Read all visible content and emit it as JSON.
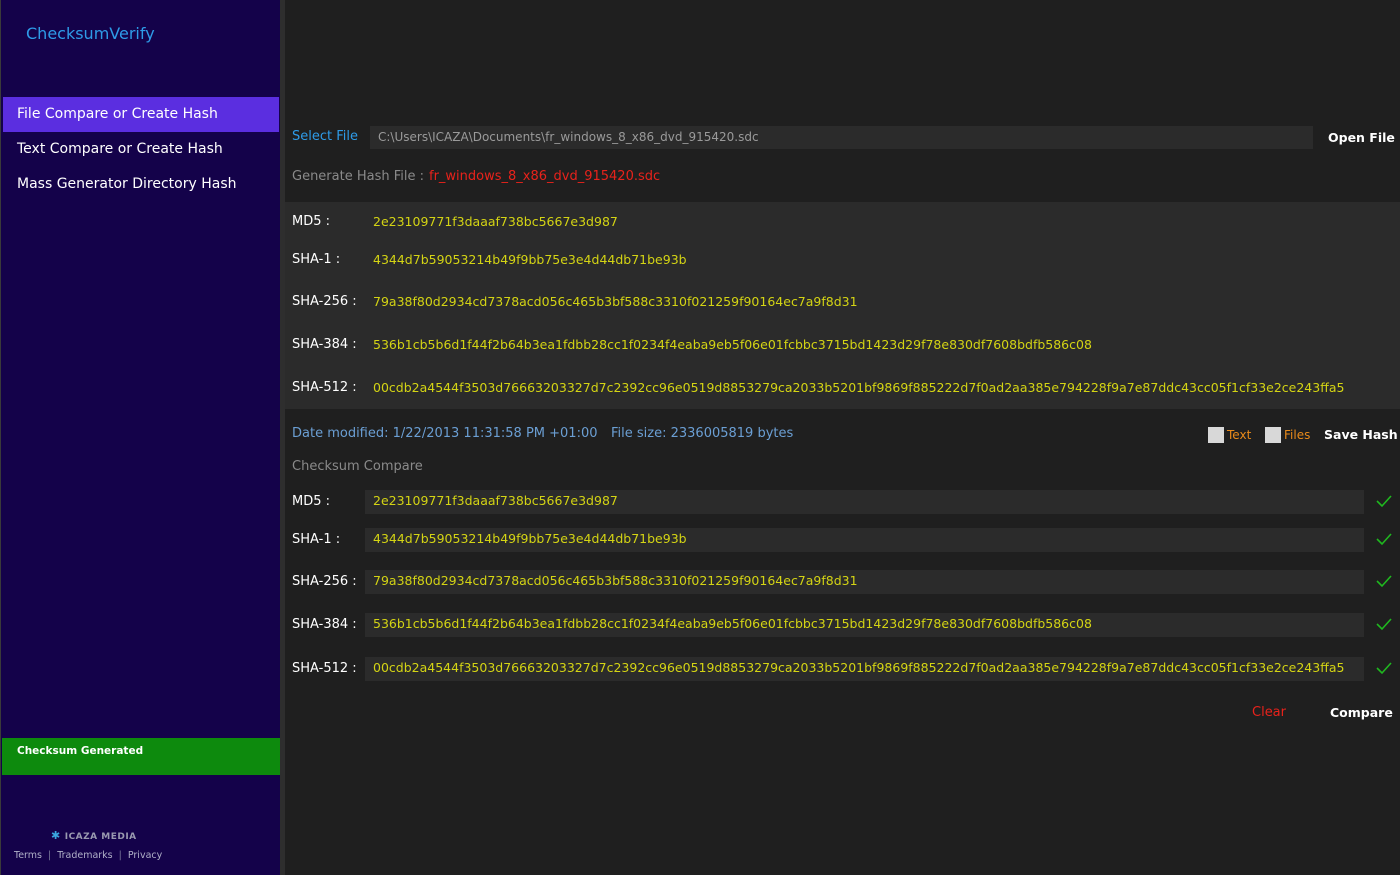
{
  "sidebar": {
    "app_title": "ChecksumVerify",
    "items": [
      {
        "label": "File Compare or Create Hash",
        "active": true
      },
      {
        "label": "Text Compare or Create Hash",
        "active": false
      },
      {
        "label": "Mass Generator Directory Hash",
        "active": false
      }
    ],
    "status": "Checksum Generated",
    "brand": "ICAZA MEDIA",
    "brand_icon": "puzzle-icon",
    "links": [
      "Terms",
      "Trademarks",
      "Privacy"
    ]
  },
  "file": {
    "select_label": "Select File",
    "path": "C:\\Users\\ICAZA\\Documents\\fr_windows_8_x86_dvd_915420.sdc",
    "open_label": "Open File",
    "generate_label": "Generate Hash File :",
    "generate_value": "fr_windows_8_x86_dvd_915420.sdc"
  },
  "hashes": [
    {
      "label": "MD5 :",
      "value": "2e23109771f3daaaf738bc5667e3d987"
    },
    {
      "label": "SHA-1 :",
      "value": "4344d7b59053214b49f9bb75e3e4d44db71be93b"
    },
    {
      "label": "SHA-256 :",
      "value": "79a38f80d2934cd7378acd056c465b3bf588c3310f021259f90164ec7a9f8d31"
    },
    {
      "label": "SHA-384 :",
      "value": "536b1cb5b6d1f44f2b64b3ea1fdbb28cc1f0234f4eaba9eb5f06e01fcbbc3715bd1423d29f78e830df7608bdfb586c08"
    },
    {
      "label": "SHA-512 :",
      "value": "00cdb2a4544f3503d76663203327d7c2392cc96e0519d8853279ca2033b5201bf9869f885222d7f0ad2aa385e794228f9a7e87ddc43cc05f1cf33e2ce243ffa5"
    }
  ],
  "info": {
    "date_modified": "Date modified: 1/22/2013 11:31:58 PM +01:00",
    "file_size": "File size: 2336005819 bytes",
    "text_checkbox": "Text",
    "files_checkbox": "Files",
    "save_hash": "Save Hash"
  },
  "compare": {
    "title": "Checksum Compare",
    "rows": [
      {
        "label": "MD5 :",
        "value": "2e23109771f3daaaf738bc5667e3d987",
        "match": true
      },
      {
        "label": "SHA-1 :",
        "value": "4344d7b59053214b49f9bb75e3e4d44db71be93b",
        "match": true
      },
      {
        "label": "SHA-256 :",
        "value": "79a38f80d2934cd7378acd056c465b3bf588c3310f021259f90164ec7a9f8d31",
        "match": true
      },
      {
        "label": "SHA-384 :",
        "value": "536b1cb5b6d1f44f2b64b3ea1fdbb28cc1f0234f4eaba9eb5f06e01fcbbc3715bd1423d29f78e830df7608bdfb586c08",
        "match": true
      },
      {
        "label": "SHA-512 :",
        "value": "00cdb2a4544f3503d76663203327d7c2392cc96e0519d8853279ca2033b5201bf9869f885222d7f0ad2aa385e794228f9a7e87ddc43cc05f1cf33e2ce243ffa5",
        "match": true
      }
    ],
    "clear_label": "Clear",
    "compare_label": "Compare"
  },
  "colors": {
    "sidebar_bg": "#14024a",
    "active_item": "#5b2ee0",
    "status_green": "#0d8a0d",
    "accent_blue": "#2e9be8",
    "hash_yellow": "#d4d414",
    "danger_red": "#e8221b",
    "checkbox_orange": "#e88a1a",
    "match_green": "#1fb81f"
  }
}
